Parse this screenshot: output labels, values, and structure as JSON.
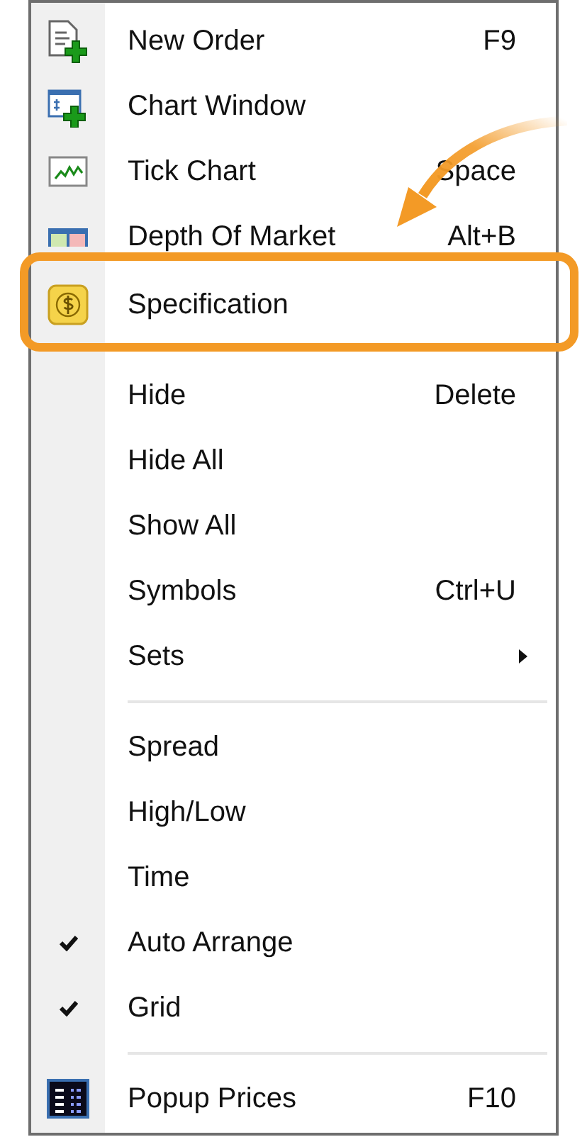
{
  "menu": {
    "items": [
      {
        "kind": "order",
        "label": "New Order",
        "shortcut": "F9",
        "checked": false,
        "callout": false
      },
      {
        "kind": "chart",
        "label": "Chart Window",
        "checked": false,
        "callout": false
      },
      {
        "kind": "tick",
        "label": "Tick Chart",
        "shortcut": "Space",
        "checked": false,
        "callout": false
      },
      {
        "kind": "depth",
        "label": "Depth Of Market",
        "shortcut": "Alt+B",
        "checked": false,
        "callout": false
      },
      {
        "kind": "spec",
        "label": "Specification",
        "checked": false,
        "callout": true
      },
      {
        "kind": "plain",
        "label": "Hide",
        "shortcut": "Delete",
        "checked": false,
        "callout": false
      },
      {
        "kind": "plain",
        "label": "Hide All",
        "checked": false,
        "callout": false
      },
      {
        "kind": "plain",
        "label": "Show All",
        "checked": false,
        "callout": false
      },
      {
        "kind": "plain",
        "label": "Symbols",
        "shortcut": "Ctrl+U",
        "checked": false,
        "callout": false
      },
      {
        "kind": "submenu",
        "label": "Sets",
        "checked": false,
        "callout": false
      },
      {
        "kind": "separator"
      },
      {
        "kind": "plain",
        "label": "Spread",
        "checked": false,
        "callout": false
      },
      {
        "kind": "plain",
        "label": "High/Low",
        "checked": false,
        "callout": false
      },
      {
        "kind": "plain",
        "label": "Time",
        "checked": false,
        "callout": false
      },
      {
        "kind": "plain",
        "label": "Auto Arrange",
        "checked": true,
        "callout": false
      },
      {
        "kind": "plain",
        "label": "Grid",
        "checked": true,
        "callout": false
      },
      {
        "kind": "separator"
      },
      {
        "kind": "popup",
        "label": "Popup Prices",
        "shortcut": "F10",
        "checked": false,
        "callout": false
      }
    ]
  }
}
